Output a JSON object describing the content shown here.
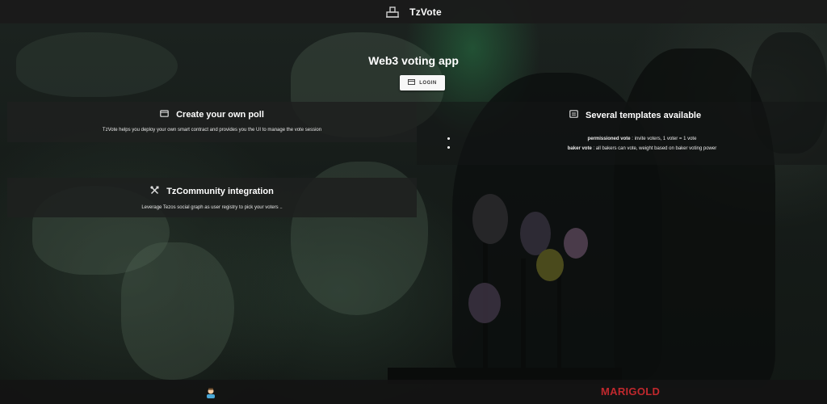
{
  "header": {
    "title": "TzVote",
    "icon": "ballot-box-icon"
  },
  "hero": {
    "title": "Web3 voting app",
    "login_label": "LOGIN",
    "login_icon": "wallet-icon"
  },
  "cards": {
    "create_poll": {
      "title": "Create your own poll",
      "icon": "ballot-icon",
      "description": "TzVote helps you deploy your own smart contract and provides you the UI to manage the vote session"
    },
    "templates": {
      "title": "Several templates available",
      "icon": "template-icon",
      "items": [
        {
          "name": "permissioned vote",
          "text": " : invite voters, 1 voter = 1 vote"
        },
        {
          "name": "baker vote",
          "text": " : all bakers can vote, weight based on baker voting power"
        }
      ]
    },
    "community": {
      "title": "TzCommunity integration",
      "icon": "tools-icon",
      "description": "Leverage Tezos social graph as user registry to pick your voters .."
    }
  },
  "footer": {
    "avatar_icon": "user-avatar-icon",
    "logo_text": "MARIGOLD",
    "logo_color": "#c0282d"
  }
}
